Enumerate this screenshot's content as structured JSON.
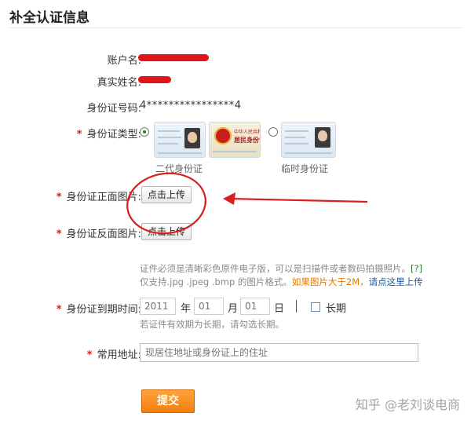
{
  "page_title": "补全认证信息",
  "fields": {
    "account_label": "账户名:",
    "realname_label": "真实姓名:",
    "idnumber_label": "身份证号码:",
    "idnumber_value": "4****************4",
    "idtype_label": "身份证类型:",
    "idtype_options": [
      "二代身份证",
      "临时身份证"
    ],
    "front_label": "身份证正面图片:",
    "back_label": "身份证反面图片:",
    "upload_button": "点击上传",
    "emblem_text_1": "中华人民共和国",
    "emblem_text_2": "居民身份证",
    "hint_line1": "证件必须是清晰彩色原件电子版，可以是扫描件或者数码拍摄照片。",
    "hint_help": "[?]",
    "hint_line2": "仅支持.jpg .jpeg .bmp 的图片格式。",
    "hint_warn": "如果图片大于2M，",
    "hint_link": "请点这里上传",
    "expire_label": "身份证到期时间:",
    "expire_year_placeholder": "2011",
    "expire_year_unit": "年",
    "expire_month_placeholder": "01",
    "expire_month_unit": "月",
    "expire_day_placeholder": "01",
    "expire_day_unit": "日",
    "longterm_label": "长期",
    "expire_hint": "若证件有效期为长期，请勾选长期。",
    "address_label": "常用地址:",
    "address_placeholder": "现居住地址或身份证上的住址",
    "required_mark": "*"
  },
  "submit_label": "提交",
  "watermark": "知乎 @老刘谈电商",
  "colors": {
    "required": "#d42020",
    "annotation": "#d81e1e",
    "submit": "#f58b1f",
    "link": "#1a57a8",
    "warn": "#e07b00"
  }
}
